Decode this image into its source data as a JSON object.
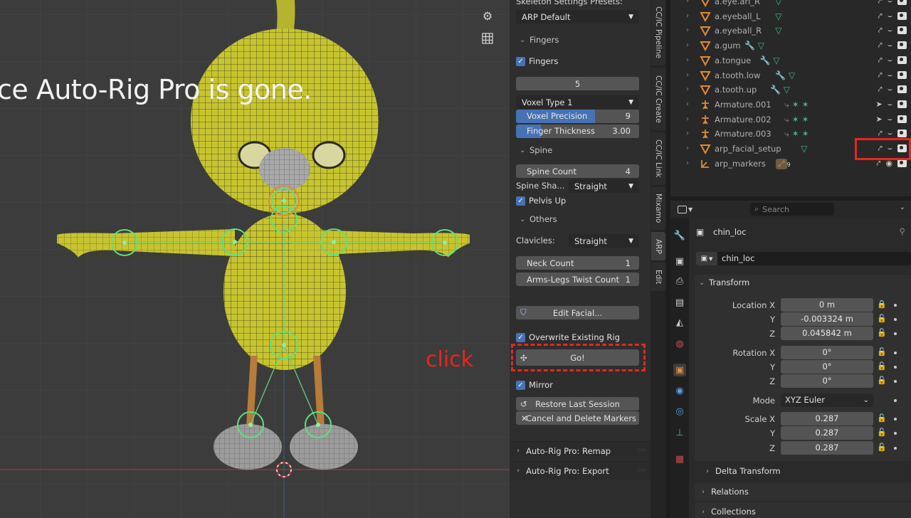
{
  "viewport": {
    "overlay_text": "ce Auto-Rig Pro is gone.",
    "click_annotation": "click"
  },
  "arp_panel": {
    "presets_label": "Skeleton Settings Presets:",
    "preset_value": "ARP Default",
    "fingers_section": "Fingers",
    "fingers_check": "Fingers",
    "finger_count": "5",
    "voxel_type": "Voxel Type 1",
    "voxel_precision": {
      "label": "Voxel Precision",
      "value": "9",
      "fill": 0.64
    },
    "finger_thickness": {
      "label": "Finger Thickness",
      "value": "3.00",
      "fill": 0.2
    },
    "spine_section": "Spine",
    "spine_count": {
      "label": "Spine Count",
      "value": "4"
    },
    "spine_shape": {
      "label": "Spine Sha...",
      "value": "Straight"
    },
    "pelvis_up": "Pelvis Up",
    "others_section": "Others",
    "clavicles": {
      "label": "Clavicles:",
      "value": "Straight"
    },
    "neck_count": {
      "label": "Neck Count",
      "value": "1"
    },
    "arms_legs_twist": {
      "label": "Arms-Legs Twist Count",
      "value": "1"
    },
    "edit_facial": "Edit Facial...",
    "overwrite_rig": "Overwrite Existing Rig",
    "go_button": "Go!",
    "mirror": "Mirror",
    "restore_session": "Restore Last Session",
    "cancel_markers": "Cancel and Delete Markers",
    "remap_section": "Auto-Rig Pro: Remap",
    "export_section": "Auto-Rig Pro: Export"
  },
  "vertical_tabs": [
    "CC/IC Pipeline",
    "CC/IC Create",
    "CC/IC Link",
    "Mixamo",
    "ARP",
    "Edit"
  ],
  "outliner": {
    "rows": [
      {
        "name": "a.eye.ari_R",
        "type": "mesh"
      },
      {
        "name": "a.eyeball_L",
        "type": "mesh"
      },
      {
        "name": "a.eyeball_R",
        "type": "mesh"
      },
      {
        "name": "a.gum",
        "type": "mesh"
      },
      {
        "name": "a.tongue",
        "type": "mesh"
      },
      {
        "name": "a.tooth.low",
        "type": "mesh"
      },
      {
        "name": "a.tooth.up",
        "type": "mesh"
      },
      {
        "name": "Armature.001",
        "type": "armature"
      },
      {
        "name": "Armature.002",
        "type": "armature"
      },
      {
        "name": "Armature.003",
        "type": "armature"
      },
      {
        "name": "arp_facial_setup",
        "type": "mesh"
      },
      {
        "name": "arp_markers",
        "type": "empty"
      }
    ],
    "marker_badge": "9"
  },
  "properties": {
    "search_placeholder": "Search",
    "object_name": "chin_loc",
    "datablock_name": "chin_loc",
    "transform_section": "Transform",
    "location": {
      "x_label": "Location X",
      "y_label": "Y",
      "z_label": "Z",
      "x": "0 m",
      "y": "-0.003324 m",
      "z": "0.045842 m"
    },
    "rotation": {
      "x_label": "Rotation X",
      "y_label": "Y",
      "z_label": "Z",
      "x": "0°",
      "y": "0°",
      "z": "0°"
    },
    "mode": {
      "label": "Mode",
      "value": "XYZ Euler"
    },
    "scale": {
      "x_label": "Scale X",
      "y_label": "Y",
      "z_label": "Z",
      "x": "0.287",
      "y": "0.287",
      "z": "0.287"
    },
    "delta_transform": "Delta Transform",
    "relations": "Relations",
    "collections": "Collections"
  },
  "colors": {
    "accent_blue": "#4772b3",
    "annotation_red": "#e8261e",
    "mesh_orange": "#e08a3a",
    "modifier_green": "#3fbf7f"
  }
}
